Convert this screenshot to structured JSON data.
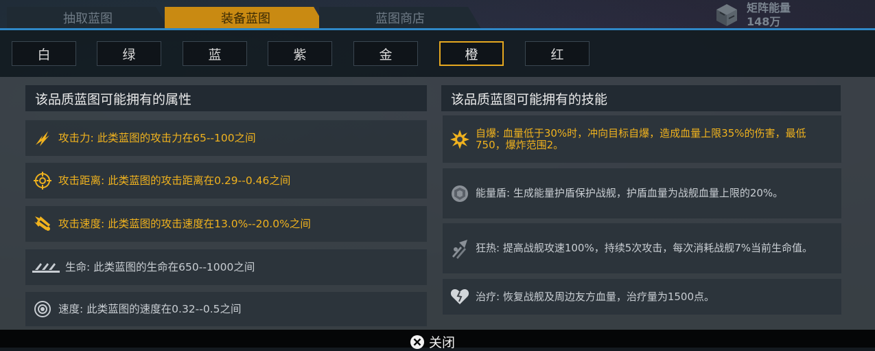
{
  "tabs": [
    {
      "label": "抽取蓝图",
      "active": false
    },
    {
      "label": "装备蓝图",
      "active": true
    },
    {
      "label": "蓝图商店",
      "active": false
    }
  ],
  "resource": {
    "name": "矩阵能量",
    "value": "148万"
  },
  "qualities": [
    {
      "label": "白",
      "active": false
    },
    {
      "label": "绿",
      "active": false
    },
    {
      "label": "蓝",
      "active": false
    },
    {
      "label": "紫",
      "active": false
    },
    {
      "label": "金",
      "active": false
    },
    {
      "label": "橙",
      "active": true
    },
    {
      "label": "红",
      "active": false
    }
  ],
  "attributes": {
    "title": "该品质蓝图可能拥有的属性",
    "items": [
      {
        "icon": "attack-power-icon",
        "text": "攻击力: 此类蓝图的攻击力在65--100之间",
        "highlight": true
      },
      {
        "icon": "crosshair-icon",
        "text": "攻击距离: 此类蓝图的攻击距离在0.29--0.46之间",
        "highlight": true
      },
      {
        "icon": "missiles-icon",
        "text": "攻击速度: 此类蓝图的攻击速度在13.0%--20.0%之间",
        "highlight": true
      },
      {
        "icon": "health-icon",
        "text": "生命: 此类蓝图的生命在650--1000之间",
        "highlight": false
      },
      {
        "icon": "speed-icon",
        "text": "速度: 此类蓝图的速度在0.32--0.5之间",
        "highlight": false
      }
    ]
  },
  "skills": {
    "title": "该品质蓝图可能拥有的技能",
    "items": [
      {
        "icon": "explosion-icon",
        "text": "自爆: 血量低于30%时，冲向目标自爆，造成血量上限35%的伤害，最低750，爆炸范围2。",
        "highlight": true
      },
      {
        "icon": "shield-icon",
        "text": "能量盾: 生成能量护盾保护战舰，护盾血量为战舰血量上限的20%。",
        "highlight": false
      },
      {
        "icon": "frenzy-icon",
        "text": "狂热: 提高战舰攻速100%，持续5次攻击，每次消耗战舰7%当前生命值。",
        "highlight": false
      },
      {
        "icon": "heal-icon",
        "text": "治疗: 恢复战舰及周边友方血量，治疗量为1500点。",
        "highlight": false
      }
    ]
  },
  "footer": {
    "close_label": "关闭"
  },
  "colors": {
    "accent_gold": "#f0b21e",
    "tab_active": "#c98a12",
    "tab_line": "#2f88c8"
  }
}
